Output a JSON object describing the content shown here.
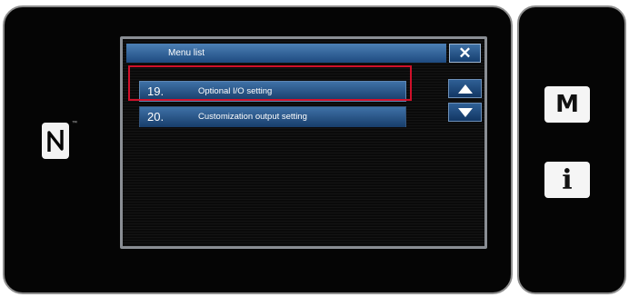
{
  "menu_list": {
    "title": "Menu list",
    "close_symbol": "✕",
    "items": [
      {
        "number": "19.",
        "label": "Optional I/O setting",
        "selected": true
      },
      {
        "number": "20.",
        "label": "Customization output setting",
        "selected": false
      }
    ],
    "scroll_up_icon": "triangle-up-icon",
    "scroll_down_icon": "triangle-down-icon"
  },
  "side_buttons": {
    "mode": "M",
    "info": "i"
  },
  "icons": {
    "nfc": "nfc-icon"
  },
  "colors": {
    "title_bar": "#1e4a80",
    "menu_item": "#2a5c93",
    "selection_frame": "#d0102a",
    "bezel": "#050505"
  }
}
